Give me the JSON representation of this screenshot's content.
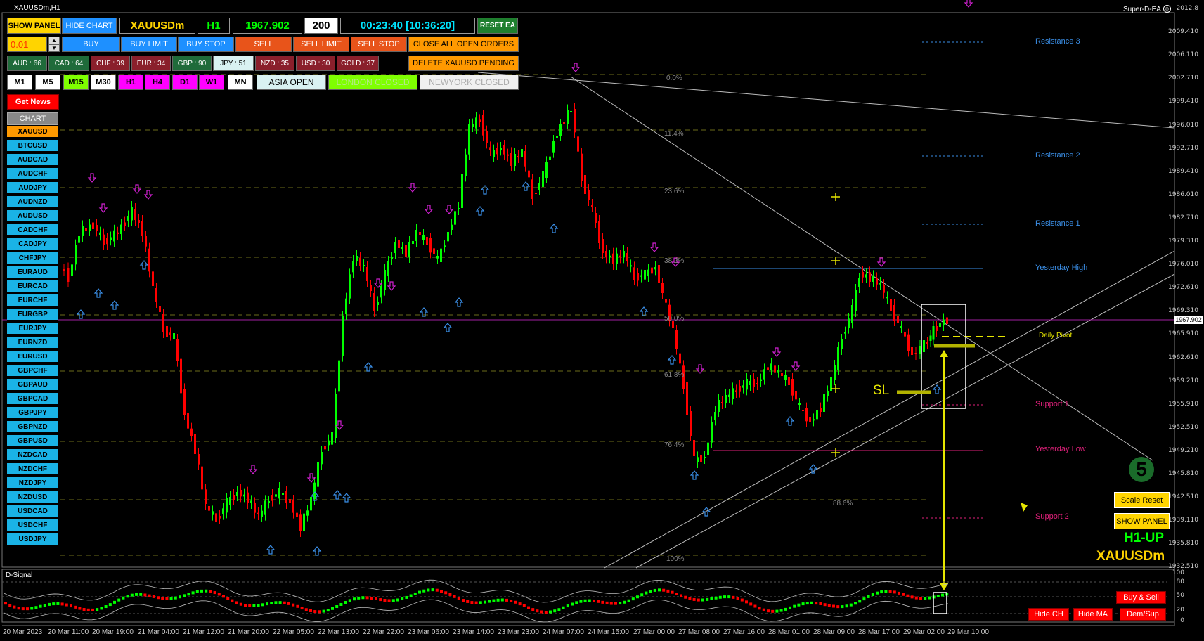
{
  "window": {
    "title": "XAUUSDm,H1",
    "ea_name": "Super-D-EA"
  },
  "toolbar": {
    "show_panel": "SHOW PANEL",
    "hide_chart": "HIDE CHART",
    "symbol": "XAUUSDm",
    "timeframe": "H1",
    "price": "1967.902",
    "spread": "200",
    "timer": "00:23:40 [10:36:20]",
    "reset_ea": "RESET EA",
    "lot_value": "0.01",
    "buy": "BUY",
    "buy_limit": "BUY LIMIT",
    "buy_stop": "BUY STOP",
    "sell": "SELL",
    "sell_limit": "SELL LIMIT",
    "sell_stop": "SELL STOP",
    "close_all": "CLOSE ALL OPEN ORDERS",
    "delete_pending": "DELETE XAUUSD PENDING"
  },
  "currency_strength": [
    {
      "label": "AUD : 66",
      "bg": "#1f6b3a"
    },
    {
      "label": "CAD : 64",
      "bg": "#1f6b3a"
    },
    {
      "label": "CHF : 39",
      "bg": "#8a1f2b"
    },
    {
      "label": "EUR : 34",
      "bg": "#8a1f2b"
    },
    {
      "label": "GBP : 90",
      "bg": "#1f6b3a"
    },
    {
      "label": "JPY : 51",
      "bg": "#d9f2f2"
    },
    {
      "label": "NZD : 35",
      "bg": "#8a1f2b"
    },
    {
      "label": "USD : 30",
      "bg": "#8a1f2b"
    },
    {
      "label": "GOLD : 37",
      "bg": "#8a1f2b"
    }
  ],
  "timeframes": [
    {
      "label": "M1",
      "bg": "#ffffff"
    },
    {
      "label": "M5",
      "bg": "#ffffff"
    },
    {
      "label": "M15",
      "bg": "#7fff00"
    },
    {
      "label": "M30",
      "bg": "#ffffff"
    },
    {
      "label": "H1",
      "bg": "#ff00ff"
    },
    {
      "label": "H4",
      "bg": "#ff00ff"
    },
    {
      "label": "D1",
      "bg": "#ff00ff"
    },
    {
      "label": "W1",
      "bg": "#ff00ff"
    },
    {
      "label": "MN",
      "bg": "#ffffff"
    }
  ],
  "sessions": {
    "asia": "ASIA OPEN",
    "london": "LONDON CLOSED",
    "newyork": "NEWYORK CLOSED"
  },
  "get_news": "Get News",
  "chart_header": "CHART",
  "symbols": [
    "XAUUSD",
    "BTCUSD",
    "AUDCAD",
    "AUDCHF",
    "AUDJPY",
    "AUDNZD",
    "AUDUSD",
    "CADCHF",
    "CADJPY",
    "CHFJPY",
    "EURAUD",
    "EURCAD",
    "EURCHF",
    "EURGBP",
    "EURJPY",
    "EURNZD",
    "EURUSD",
    "GBPCHF",
    "GBPAUD",
    "GBPCAD",
    "GBPJPY",
    "GBPNZD",
    "GBPUSD",
    "NZDCAD",
    "NZDCHF",
    "NZDJPY",
    "NZDUSD",
    "USDCAD",
    "USDCHF",
    "USDJPY"
  ],
  "price_axis": [
    "2012.8",
    "2009.410",
    "2006.110",
    "2002.710",
    "1999.410",
    "1996.010",
    "1992.710",
    "1989.410",
    "1986.010",
    "1982.710",
    "1979.310",
    "1976.010",
    "1972.610",
    "1969.310",
    "1965.910",
    "1962.610",
    "1959.210",
    "1955.910",
    "1952.510",
    "1949.210",
    "1945.810",
    "1942.510",
    "1939.110",
    "1935.810",
    "1932.510"
  ],
  "current_price_tag": "1967.902",
  "time_axis": [
    "20 Mar 2023",
    "20 Mar 11:00",
    "20 Mar 19:00",
    "21 Mar 04:00",
    "21 Mar 12:00",
    "21 Mar 20:00",
    "22 Mar 05:00",
    "22 Mar 13:00",
    "22 Mar 22:00",
    "23 Mar 06:00",
    "23 Mar 14:00",
    "23 Mar 23:00",
    "24 Mar 07:00",
    "24 Mar 15:00",
    "27 Mar 00:00",
    "27 Mar 08:00",
    "27 Mar 16:00",
    "28 Mar 01:00",
    "28 Mar 09:00",
    "28 Mar 17:00",
    "29 Mar 02:00",
    "29 Mar 10:00"
  ],
  "fib_levels": [
    "0.0%",
    "11.4%",
    "23.6%",
    "38.2%",
    "50.0%",
    "61.8%",
    "76.4%",
    "88.6%",
    "100%"
  ],
  "levels": {
    "resistance3": "Resistance 3",
    "resistance2": "Resistance 2",
    "resistance1": "Resistance 1",
    "yesterday_high": "Yesterday High",
    "daily_pivot": "Daily Pivot",
    "support1": "Support 1",
    "yesterday_low": "Yesterday Low",
    "support2": "Support 2"
  },
  "sl_label": "SL",
  "right_panel": {
    "count": "5",
    "scale_reset": "Scale Reset",
    "show_panel": "SHOW PANEL",
    "trend": "H1-UP",
    "symbol": "XAUUSDm"
  },
  "indicator": {
    "name": "D-Signal",
    "scale": [
      "100",
      "80",
      "50",
      "20",
      "0"
    ],
    "buy_sell": "Buy & Sell",
    "hide_ch": "Hide CH",
    "hide_ma": "Hide MA",
    "dem_sup": "Dem/Sup"
  },
  "colors": {
    "bull": "#00ff00",
    "bear": "#ff0000",
    "resistance": "#3a8ee6",
    "support": "#e0207a",
    "pivot": "#e6e600"
  }
}
